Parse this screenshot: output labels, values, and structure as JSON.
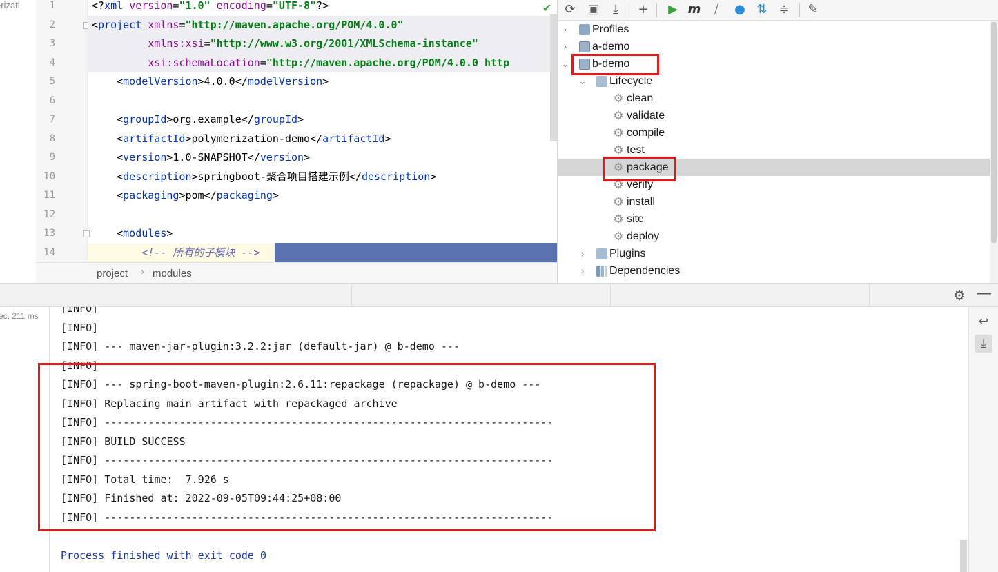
{
  "left_edge": {
    "text": "erizati"
  },
  "editor": {
    "lines": [
      {
        "no": "1",
        "html": "<span class='t'>&lt;?</span><span class='tag'>xml</span> <span class='ns'>version</span>=<span class='str'>\"1.0\"</span> <span class='ns'>encoding</span>=<span class='str'>\"UTF-8\"</span><span class='t'>?&gt;</span>"
      },
      {
        "no": "2",
        "html": "<span class='t'>&lt;</span><span class='tag'>project</span> <span class='ns'>xmlns</span>=<span class='str'>\"http://maven.apache.org/POM/4.0.0\"</span>"
      },
      {
        "no": "3",
        "html": "         <span class='ns'>xmlns:xsi</span>=<span class='str'>\"http://www.w3.org/2001/XMLSchema-instance\"</span>"
      },
      {
        "no": "4",
        "html": "         <span class='ns'>xsi:schemaLocation</span>=<span class='str'>\"http://maven.apache.org/POM/4.0.0 http</span>"
      },
      {
        "no": "5",
        "html": "    <span class='t'>&lt;</span><span class='tag'>modelVersion</span><span class='t'>&gt;4.0.0&lt;/</span><span class='tag'>modelVersion</span><span class='t'>&gt;</span>"
      },
      {
        "no": "6",
        "html": ""
      },
      {
        "no": "7",
        "html": "    <span class='t'>&lt;</span><span class='tag'>groupId</span><span class='t'>&gt;org.example&lt;/</span><span class='tag'>groupId</span><span class='t'>&gt;</span>"
      },
      {
        "no": "8",
        "html": "    <span class='t'>&lt;</span><span class='tag'>artifactId</span><span class='t'>&gt;polymerization-demo&lt;/</span><span class='tag'>artifactId</span><span class='t'>&gt;</span>"
      },
      {
        "no": "9",
        "html": "    <span class='t'>&lt;</span><span class='tag'>version</span><span class='t'>&gt;1.0-SNAPSHOT&lt;/</span><span class='tag'>version</span><span class='t'>&gt;</span>"
      },
      {
        "no": "10",
        "html": "    <span class='t'>&lt;</span><span class='tag'>description</span><span class='t'>&gt;springboot-聚合项目搭建示例&lt;/</span><span class='tag'>description</span><span class='t'>&gt;</span>"
      },
      {
        "no": "11",
        "html": "    <span class='t'>&lt;</span><span class='tag'>packaging</span><span class='t'>&gt;pom&lt;/</span><span class='tag'>packaging</span><span class='t'>&gt;</span>"
      },
      {
        "no": "12",
        "html": ""
      },
      {
        "no": "13",
        "html": "    <span class='t'>&lt;</span><span class='tag'>modules</span><span class='t'>&gt;</span>"
      },
      {
        "no": "14",
        "html": "        <span class='cmt'>&lt;!-- 所有的子模块 --&gt;</span>"
      }
    ],
    "breadcrumb": [
      "project",
      "modules"
    ]
  },
  "maven": {
    "tree": [
      {
        "label": "Profiles",
        "level": 0,
        "chevron": "›",
        "icon": "folder"
      },
      {
        "label": "a-demo",
        "level": 0,
        "chevron": "›",
        "icon": "module"
      },
      {
        "label": "b-demo",
        "level": 0,
        "chevron": "⌄",
        "icon": "module"
      },
      {
        "label": "Lifecycle",
        "level": 1,
        "chevron": "⌄",
        "icon": "lifecycle"
      },
      {
        "label": "clean",
        "level": 2,
        "icon": "gear"
      },
      {
        "label": "validate",
        "level": 2,
        "icon": "gear"
      },
      {
        "label": "compile",
        "level": 2,
        "icon": "gear"
      },
      {
        "label": "test",
        "level": 2,
        "icon": "gear"
      },
      {
        "label": "package",
        "level": 2,
        "icon": "gear",
        "selected": true
      },
      {
        "label": "verify",
        "level": 2,
        "icon": "gear"
      },
      {
        "label": "install",
        "level": 2,
        "icon": "gear"
      },
      {
        "label": "site",
        "level": 2,
        "icon": "gear"
      },
      {
        "label": "deploy",
        "level": 2,
        "icon": "gear"
      },
      {
        "label": "Plugins",
        "level": 1,
        "chevron": "›",
        "icon": "lifecycle"
      },
      {
        "label": "Dependencies",
        "level": 1,
        "chevron": "›",
        "icon": "deps"
      }
    ]
  },
  "run": {
    "timing": "ec, 211 ms",
    "log": [
      "[INFO]",
      "[INFO]",
      "[INFO] --- maven-jar-plugin:3.2.2:jar (default-jar) @ b-demo ---",
      "[INFO]",
      "[INFO] --- spring-boot-maven-plugin:2.6.11:repackage (repackage) @ b-demo ---",
      "[INFO] Replacing main artifact with repackaged archive",
      "[INFO] ------------------------------------------------------------------------",
      "[INFO] BUILD SUCCESS",
      "[INFO] ------------------------------------------------------------------------",
      "[INFO] Total time:  7.926 s",
      "[INFO] Finished at: 2022-09-05T09:44:25+08:00",
      "[INFO] ------------------------------------------------------------------------",
      "",
      "Process finished with exit code 0"
    ]
  },
  "colors": {
    "highlight_red": "#e0191b",
    "selection_blue": "#5873b0",
    "tree_selected": "#d5d5d5"
  }
}
